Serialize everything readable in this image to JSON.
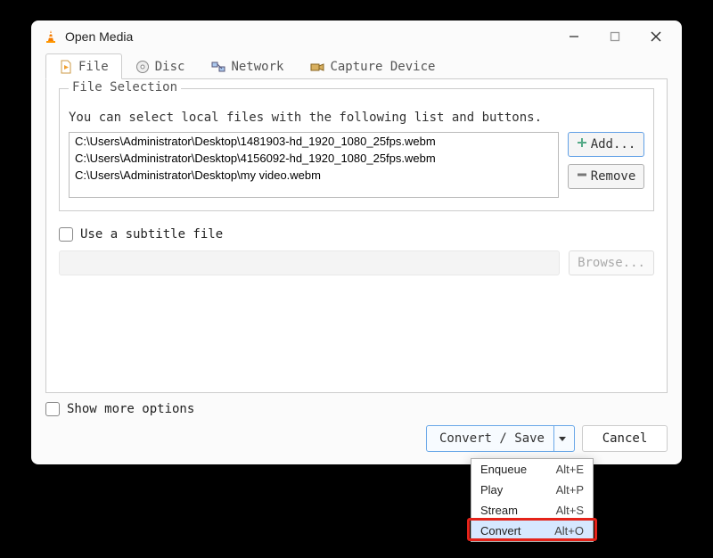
{
  "window": {
    "title": "Open Media"
  },
  "tabs": {
    "file": "File",
    "disc": "Disc",
    "network": "Network",
    "capture": "Capture Device"
  },
  "file_selection": {
    "legend": "File Selection",
    "help": "You can select local files with the following list and buttons.",
    "files": [
      "C:\\Users\\Administrator\\Desktop\\1481903-hd_1920_1080_25fps.webm",
      "C:\\Users\\Administrator\\Desktop\\4156092-hd_1920_1080_25fps.webm",
      "C:\\Users\\Administrator\\Desktop\\my video.webm"
    ],
    "add_label": "Add...",
    "remove_label": "Remove"
  },
  "subtitle": {
    "checkbox_label": "Use a subtitle file",
    "browse_label": "Browse..."
  },
  "show_more": {
    "label": "Show more options"
  },
  "actions": {
    "convert_save": "Convert / Save",
    "cancel": "Cancel"
  },
  "dropdown": {
    "items": [
      {
        "label": "Enqueue",
        "shortcut": "Alt+E"
      },
      {
        "label": "Play",
        "shortcut": "Alt+P"
      },
      {
        "label": "Stream",
        "shortcut": "Alt+S"
      },
      {
        "label": "Convert",
        "shortcut": "Alt+O"
      }
    ],
    "highlighted_index": 3
  }
}
